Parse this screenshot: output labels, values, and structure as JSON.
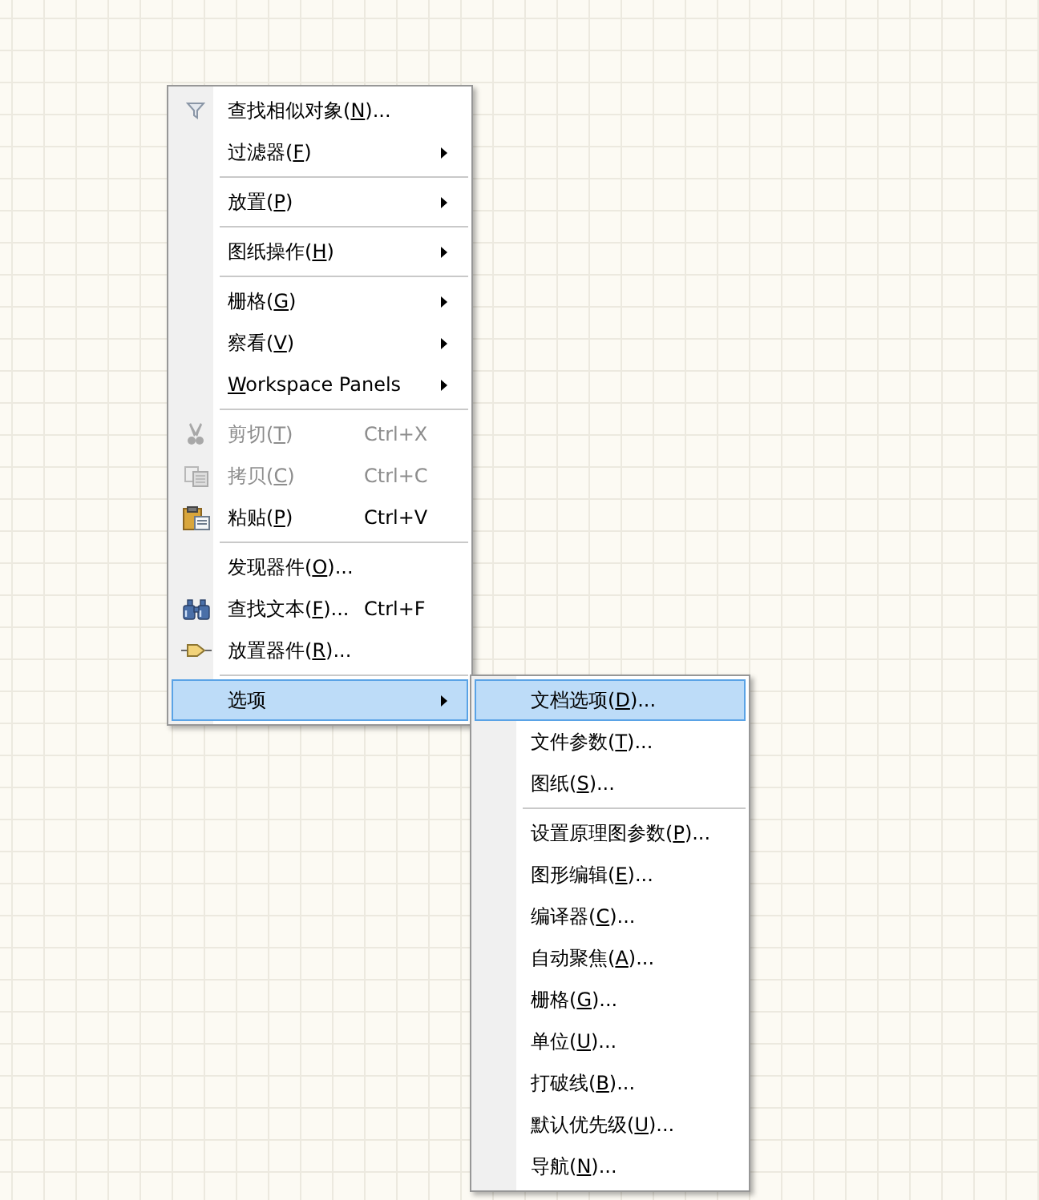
{
  "context_menu": {
    "items": [
      {
        "kind": "item",
        "label": [
          {
            "text": "查找相似对象("
          },
          {
            "text": "N",
            "underlined": true
          },
          {
            "text": ")..."
          }
        ],
        "submenu": false,
        "disabled": false,
        "selected": false
      },
      {
        "kind": "item",
        "label": [
          {
            "text": "过滤器("
          },
          {
            "text": "F",
            "underlined": true
          },
          {
            "text": ")"
          }
        ],
        "submenu": true,
        "disabled": false,
        "selected": false
      },
      {
        "kind": "separator"
      },
      {
        "kind": "item",
        "label": [
          {
            "text": "放置("
          },
          {
            "text": "P",
            "underlined": true
          },
          {
            "text": ")"
          }
        ],
        "submenu": true,
        "disabled": false,
        "selected": false
      },
      {
        "kind": "separator"
      },
      {
        "kind": "item",
        "label": [
          {
            "text": "图纸操作("
          },
          {
            "text": "H",
            "underlined": true
          },
          {
            "text": ")"
          }
        ],
        "submenu": true,
        "disabled": false,
        "selected": false
      },
      {
        "kind": "separator"
      },
      {
        "kind": "item",
        "label": [
          {
            "text": "栅格("
          },
          {
            "text": "G",
            "underlined": true
          },
          {
            "text": ")"
          }
        ],
        "submenu": true,
        "disabled": false,
        "selected": false
      },
      {
        "kind": "item",
        "label": [
          {
            "text": "察看("
          },
          {
            "text": "V",
            "underlined": true
          },
          {
            "text": ")"
          }
        ],
        "submenu": true,
        "disabled": false,
        "selected": false
      },
      {
        "kind": "item",
        "label": [
          {
            "text": "W",
            "underlined": true
          },
          {
            "text": "orkspace Panels"
          }
        ],
        "submenu": true,
        "disabled": false,
        "selected": false
      },
      {
        "kind": "separator"
      },
      {
        "kind": "item",
        "label": [
          {
            "text": "剪切("
          },
          {
            "text": "T",
            "underlined": true
          },
          {
            "text": ")"
          }
        ],
        "shortcut": "Ctrl+X",
        "submenu": false,
        "disabled": true,
        "selected": false
      },
      {
        "kind": "item",
        "label": [
          {
            "text": "拷贝("
          },
          {
            "text": "C",
            "underlined": true
          },
          {
            "text": ")"
          }
        ],
        "shortcut": "Ctrl+C",
        "submenu": false,
        "disabled": true,
        "selected": false
      },
      {
        "kind": "item",
        "label": [
          {
            "text": "粘贴("
          },
          {
            "text": "P",
            "underlined": true
          },
          {
            "text": ")"
          }
        ],
        "shortcut": "Ctrl+V",
        "submenu": false,
        "disabled": false,
        "selected": false
      },
      {
        "kind": "separator"
      },
      {
        "kind": "item",
        "label": [
          {
            "text": "发现器件("
          },
          {
            "text": "O",
            "underlined": true
          },
          {
            "text": ")..."
          }
        ],
        "submenu": false,
        "disabled": false,
        "selected": false
      },
      {
        "kind": "item",
        "label": [
          {
            "text": "查找文本("
          },
          {
            "text": "F",
            "underlined": true
          },
          {
            "text": ")..."
          }
        ],
        "shortcut": "Ctrl+F",
        "submenu": false,
        "disabled": false,
        "selected": false
      },
      {
        "kind": "item",
        "label": [
          {
            "text": "放置器件("
          },
          {
            "text": "R",
            "underlined": true
          },
          {
            "text": ")..."
          }
        ],
        "submenu": false,
        "disabled": false,
        "selected": false
      },
      {
        "kind": "separator"
      },
      {
        "kind": "item",
        "label": [
          {
            "text": "选项"
          }
        ],
        "submenu": true,
        "disabled": false,
        "selected": true
      }
    ]
  },
  "submenu": {
    "items": [
      {
        "kind": "item",
        "label": [
          {
            "text": "文档选项("
          },
          {
            "text": "D",
            "underlined": true
          },
          {
            "text": ")..."
          }
        ],
        "selected": true
      },
      {
        "kind": "item",
        "label": [
          {
            "text": "文件参数("
          },
          {
            "text": "T",
            "underlined": true
          },
          {
            "text": ")..."
          }
        ],
        "selected": false
      },
      {
        "kind": "item",
        "label": [
          {
            "text": "图纸("
          },
          {
            "text": "S",
            "underlined": true
          },
          {
            "text": ")..."
          }
        ],
        "selected": false
      },
      {
        "kind": "separator"
      },
      {
        "kind": "item",
        "label": [
          {
            "text": "设置原理图参数("
          },
          {
            "text": "P",
            "underlined": true
          },
          {
            "text": ")..."
          }
        ],
        "selected": false
      },
      {
        "kind": "item",
        "label": [
          {
            "text": "图形编辑("
          },
          {
            "text": "E",
            "underlined": true
          },
          {
            "text": ")..."
          }
        ],
        "selected": false
      },
      {
        "kind": "item",
        "label": [
          {
            "text": "编译器("
          },
          {
            "text": "C",
            "underlined": true
          },
          {
            "text": ")..."
          }
        ],
        "selected": false
      },
      {
        "kind": "item",
        "label": [
          {
            "text": "自动聚焦("
          },
          {
            "text": "A",
            "underlined": true
          },
          {
            "text": ")..."
          }
        ],
        "selected": false
      },
      {
        "kind": "item",
        "label": [
          {
            "text": "栅格("
          },
          {
            "text": "G",
            "underlined": true
          },
          {
            "text": ")..."
          }
        ],
        "selected": false
      },
      {
        "kind": "item",
        "label": [
          {
            "text": "单位("
          },
          {
            "text": "U",
            "underlined": true
          },
          {
            "text": ")..."
          }
        ],
        "selected": false
      },
      {
        "kind": "item",
        "label": [
          {
            "text": "打破线("
          },
          {
            "text": "B",
            "underlined": true
          },
          {
            "text": ")..."
          }
        ],
        "selected": false
      },
      {
        "kind": "item",
        "label": [
          {
            "text": "默认优先级("
          },
          {
            "text": "U",
            "underlined": true
          },
          {
            "text": ")..."
          }
        ],
        "selected": false
      },
      {
        "kind": "item",
        "label": [
          {
            "text": "导航("
          },
          {
            "text": "N",
            "underlined": true
          },
          {
            "text": ")..."
          }
        ],
        "selected": false
      }
    ]
  }
}
